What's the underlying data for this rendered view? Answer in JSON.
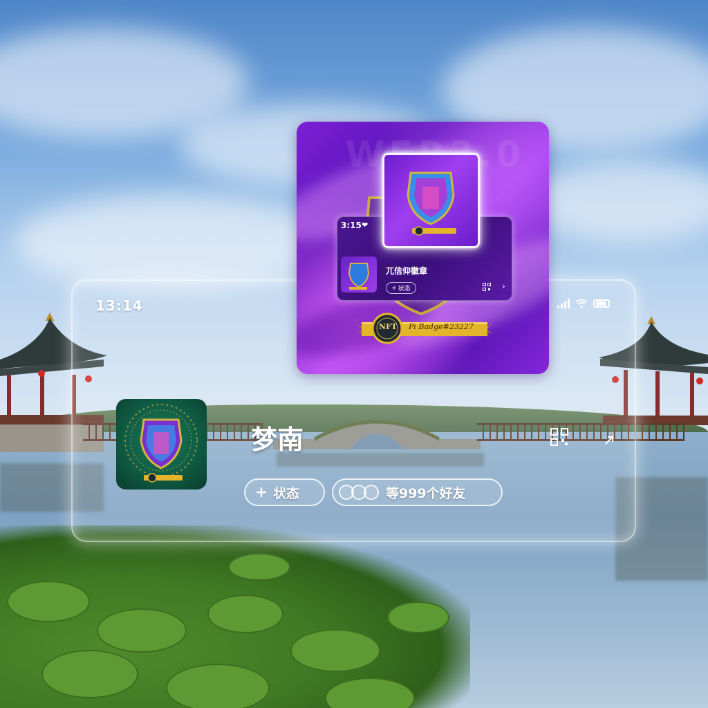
{
  "status_bar": {
    "time": "13:14"
  },
  "profile": {
    "nickname": "梦南",
    "status_chip_label": "状态",
    "friends_text": "等999个好友"
  },
  "nft_card": {
    "watermark": "WEB3.0",
    "badge_text": "Pi Badge#23227",
    "seal_text": "NFT",
    "inner_preview": {
      "time": "3:15",
      "name": "兀信仰徽章",
      "status_chip_label": "状态"
    }
  },
  "icons": [
    "plus-icon",
    "qr-code-icon",
    "arrow-icon",
    "signal-icon",
    "wifi-icon",
    "battery-icon",
    "heart-icon",
    "chevron-right-icon"
  ],
  "colors": {
    "card_purple": "#7d1fd6",
    "ribbon_gold": "#e3b52b",
    "avatar_green": "#0f5c44",
    "text_white": "#ffffff"
  }
}
